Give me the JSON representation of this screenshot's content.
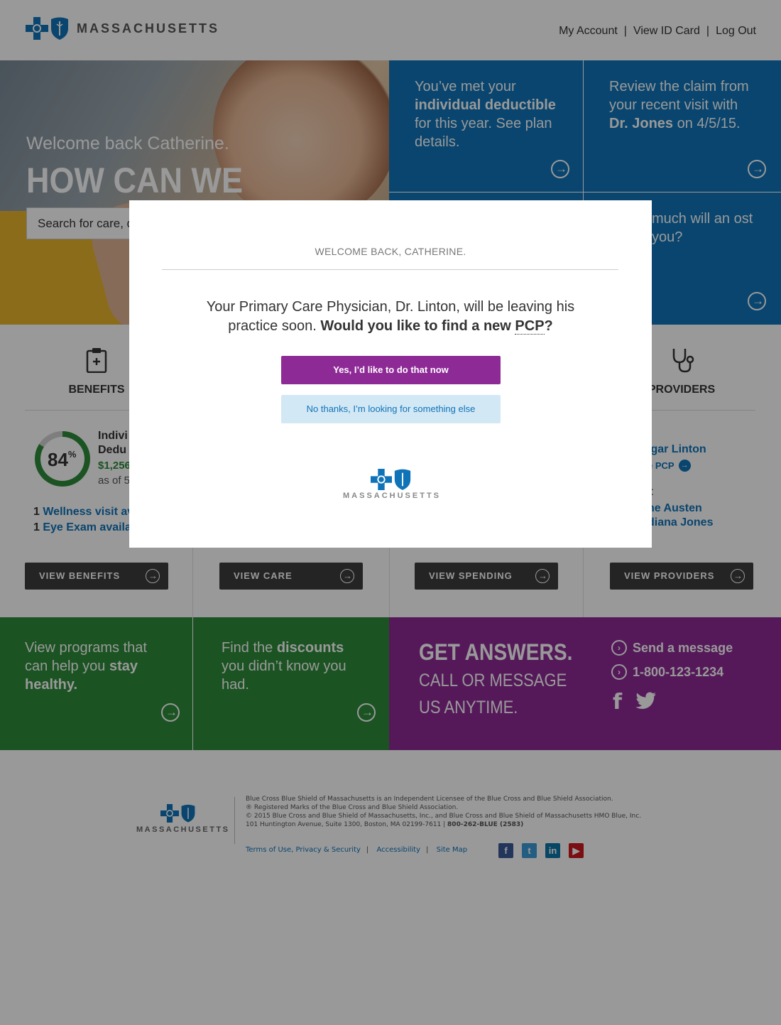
{
  "header": {
    "brand": "MASSACHUSETTS",
    "nav": [
      {
        "label": "My Account"
      },
      {
        "label": "View ID Card"
      },
      {
        "label": "Log Out"
      }
    ]
  },
  "hero": {
    "welcome": "Welcome back Catherine.",
    "headline": "HOW CAN WE HELP?",
    "search_placeholder": "Search for care, d"
  },
  "tiles": {
    "deductible": {
      "pre": "You’ve met your ",
      "strong": "individual deductible",
      "post": " for this year. See plan details."
    },
    "claim": {
      "pre": "Review the claim from your recent visit with ",
      "strong": "Dr. Jones",
      "post": " on 4/5/15."
    },
    "cost": {
      "text": "much will an ost you?"
    }
  },
  "categories": [
    {
      "title": "BENEFITS",
      "button": "VIEW BENEFITS"
    },
    {
      "title": "",
      "button": "VIEW CARE"
    },
    {
      "title": "",
      "button": "VIEW SPENDING"
    },
    {
      "title": "PROVIDERS",
      "button": "VIEW PROVIDERS"
    }
  ],
  "benefits": {
    "percent": "84",
    "percent_unit": "%",
    "percent_value": 84,
    "label_line1": "Indivi",
    "label_line2": "Dedu",
    "amount": "$1,256",
    "asof": "as of 5",
    "items": [
      {
        "count": "1",
        "label": "Wellness visit ava"
      },
      {
        "count": "1",
        "label": "Eye Exam availab"
      }
    ]
  },
  "providers": {
    "pcp_name": "lgar Linton",
    "pcp_link": "e PCP",
    "recent_label": "t:",
    "recent": [
      "ne Austen",
      "diana Jones"
    ]
  },
  "promos": {
    "programs": {
      "pre": "View programs that can help you ",
      "strong": "stay healthy."
    },
    "discounts": {
      "pre": "Find the ",
      "strong": "discounts",
      "post": " you didn’t know you had."
    },
    "answers_big": "GET ANSWERS.",
    "answers_small_1": "CALL OR MESSAGE",
    "answers_small_2": "US ANYTIME.",
    "send_message": "Send a message",
    "phone": "1-800-123-1234"
  },
  "footer": {
    "brand": "MASSACHUSETTS",
    "lines": [
      "Blue Cross Blue Shield of Massachusetts is an Independent Licensee of the Blue Cross and Blue Shield Association.",
      "® Registered Marks of the Blue Cross and Blue Shield Association.",
      "© 2015 Blue Cross and Blue Shield of Massachusetts, Inc., and Blue Cross and Blue Shield of Massachusetts HMO Blue, Inc.",
      "101 Huntington Avenue, Suite 1300, Boston, MA 02199-7611 | "
    ],
    "phone_bold": "800-262-BLUE (2583)",
    "links": [
      "Terms of Use, Privacy & Security",
      "Accessibility",
      "Site Map"
    ],
    "social_colors": {
      "facebook": "#3b5998",
      "twitter": "#3b9cd9",
      "linkedin": "#0e76a8",
      "youtube": "#cc181e"
    }
  },
  "modal": {
    "title": "WELCOME BACK, CATHERINE.",
    "body_pre": "Your Primary Care Physician, Dr. Linton, will be leaving his practice soon.  ",
    "body_strong_pre": "Would you like to find a new ",
    "body_abbr": "PCP",
    "body_strong_post": "?",
    "yes": "Yes, I’d like to do that now",
    "no": "No thanks, I’m looking for something else",
    "brand": "MASSACHUSETTS"
  },
  "colors": {
    "brand_blue": "#0f73b8",
    "green": "#2e8b3a",
    "purple": "#8e2a96",
    "dark_button": "#3d3d3d"
  }
}
